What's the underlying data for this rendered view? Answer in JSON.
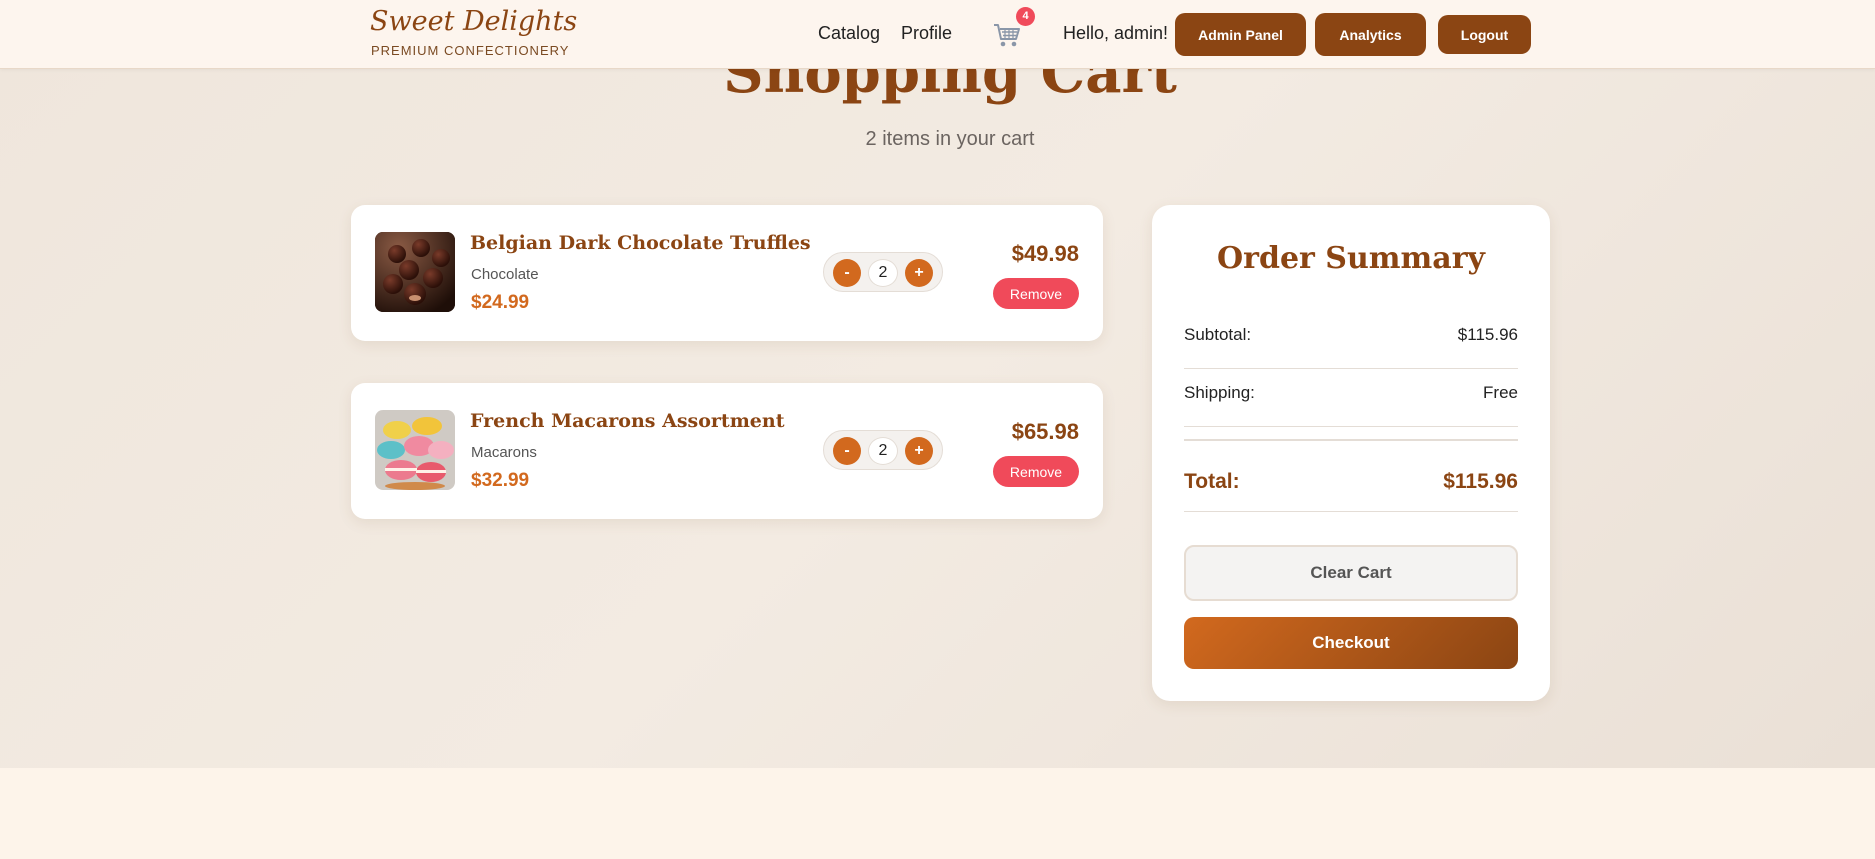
{
  "brand": {
    "name": "Sweet Delights",
    "tagline": "PREMIUM CONFECTIONERY"
  },
  "nav": {
    "links": [
      "Catalog",
      "Profile"
    ],
    "cart_badge": "4",
    "greeting": "Hello, admin!",
    "buttons": [
      "Admin Panel",
      "Analytics",
      "Logout"
    ]
  },
  "page": {
    "title": "Shopping Cart",
    "subtitle": "2 items in your cart"
  },
  "cart": {
    "items": [
      {
        "name": "Belgian Dark Chocolate Truffles",
        "category": "Chocolate",
        "price": "$24.99",
        "quantity": "2",
        "line_total": "$49.98",
        "remove_label": "Remove",
        "decrement": "-",
        "increment": "+"
      },
      {
        "name": "French Macarons Assortment",
        "category": "Macarons",
        "price": "$32.99",
        "quantity": "2",
        "line_total": "$65.98",
        "remove_label": "Remove",
        "decrement": "-",
        "increment": "+"
      }
    ]
  },
  "summary": {
    "title": "Order Summary",
    "subtitle_label": "Subtotal:",
    "subtotal": "$115.96",
    "shipping_label": "Shipping:",
    "shipping": "Free",
    "total_label": "Total:",
    "total": "$115.96",
    "clear_label": "Clear Cart",
    "checkout_label": "Checkout"
  },
  "colors": {
    "brand": "#8b4513",
    "accent": "#d2691e",
    "danger": "#f04a5a"
  }
}
